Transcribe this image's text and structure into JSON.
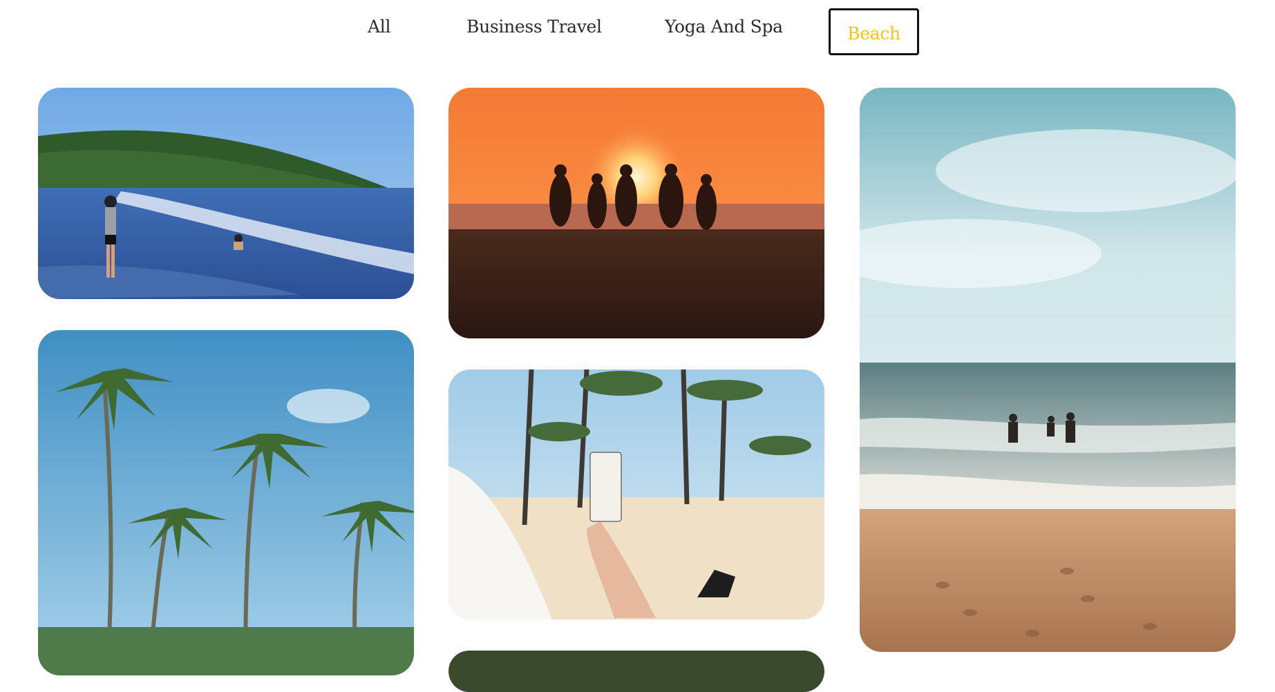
{
  "filters": {
    "all": "All",
    "business_travel": "Business Travel",
    "yoga_and_spa": "Yoga And Spa",
    "beach": "Beach",
    "active": "beach"
  },
  "colors": {
    "accent": "#f2c418",
    "text": "#2b2b2b",
    "border": "#111111"
  },
  "gallery": [
    {
      "name": "beach-waves-people-photo"
    },
    {
      "name": "sunset-group-silhouette-photo"
    },
    {
      "name": "surfers-ocean-sand-photo"
    },
    {
      "name": "palm-trees-sky-photo"
    },
    {
      "name": "beach-drink-palms-photo"
    },
    {
      "name": "partial-photo-bottom"
    }
  ]
}
